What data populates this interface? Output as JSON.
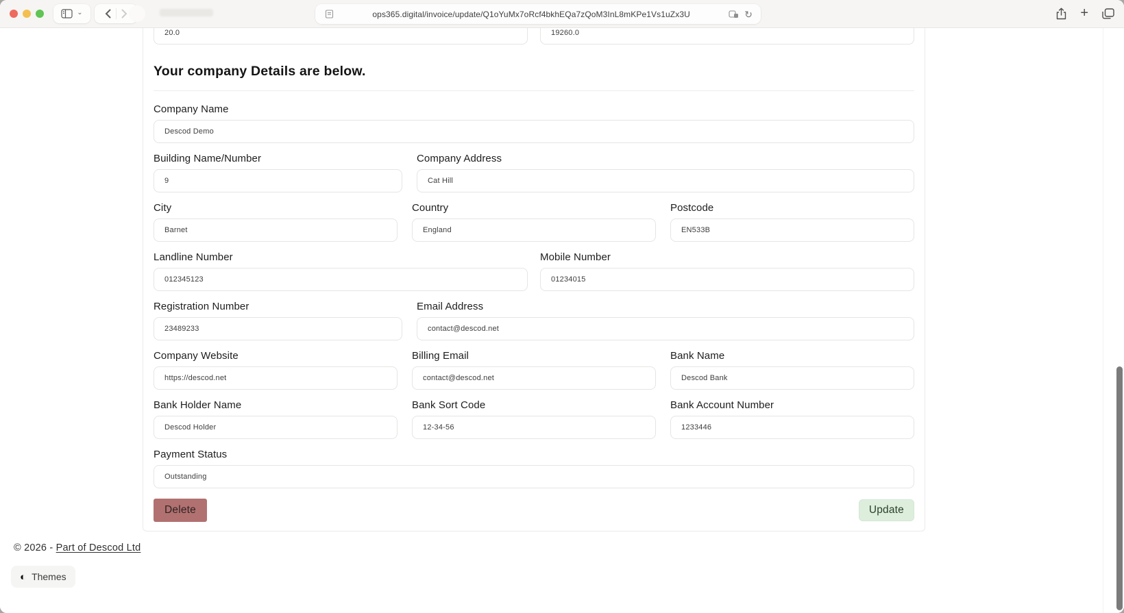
{
  "browser": {
    "url": "ops365.digital/invoice/update/Q1oYuMx7oRcf4bkhEQa7zQoM3InL8mKPe1Vs1uZx3U",
    "traffic_light_colors": {
      "close": "#ee6a5e",
      "minimize": "#f4bf4f",
      "zoom": "#61c454"
    },
    "icons": {
      "sidebar_toggle": "sidebar-panel",
      "chevron_down": "⌄",
      "back": "‹",
      "forward": "›",
      "reader": "page-lines",
      "privacy_badge": "badge",
      "refresh": "↻",
      "share": "square-arrow-up",
      "new_tab": "+",
      "tab_overview": "overlapping-squares"
    }
  },
  "page": {
    "partial_row": {
      "left_value": "20.0",
      "right_value": "19260.0"
    },
    "heading": "Your company Details are below.",
    "form": {
      "rows": [
        {
          "cols": [
            {
              "id": "company-name",
              "label": "Company Name",
              "value": "Descod Demo"
            }
          ]
        },
        {
          "cols": [
            {
              "id": "building-name-number",
              "label": "Building Name/Number",
              "value": "9"
            },
            {
              "id": "company-address",
              "label": "Company Address",
              "value": "Cat Hill"
            }
          ]
        },
        {
          "cols": [
            {
              "id": "city",
              "label": "City",
              "value": "Barnet"
            },
            {
              "id": "country",
              "label": "Country",
              "value": "England"
            },
            {
              "id": "postcode",
              "label": "Postcode",
              "value": "EN533B"
            }
          ]
        },
        {
          "cols": [
            {
              "id": "landline-number",
              "label": "Landline Number",
              "value": "012345123"
            },
            {
              "id": "mobile-number",
              "label": "Mobile Number",
              "value": "01234015"
            }
          ]
        },
        {
          "cols": [
            {
              "id": "registration-number",
              "label": "Registration Number",
              "value": "23489233"
            },
            {
              "id": "email-address",
              "label": "Email Address",
              "value": "contact@descod.net"
            }
          ]
        },
        {
          "cols": [
            {
              "id": "company-website",
              "label": "Company Website",
              "value": "https://descod.net"
            },
            {
              "id": "billing-email",
              "label": "Billing Email",
              "value": "contact@descod.net"
            },
            {
              "id": "bank-name",
              "label": "Bank Name",
              "value": "Descod Bank"
            }
          ]
        },
        {
          "cols": [
            {
              "id": "bank-holder-name",
              "label": "Bank Holder Name",
              "value": "Descod Holder"
            },
            {
              "id": "bank-sort-code",
              "label": "Bank Sort Code",
              "value": "12-34-56"
            },
            {
              "id": "bank-account-number",
              "label": "Bank Account Number",
              "value": "1233446"
            }
          ]
        },
        {
          "cols": [
            {
              "id": "payment-status",
              "label": "Payment Status",
              "value": "Outstanding"
            }
          ]
        }
      ]
    },
    "buttons": {
      "delete": "Delete",
      "update": "Update"
    },
    "button_colors": {
      "delete_bg": "#b17170",
      "update_bg": "#ddeedd"
    },
    "footer": {
      "copyright_prefix": "© 2026 - ",
      "link_text": "Part of Descod Ltd"
    },
    "themes": {
      "label": "Themes",
      "icon_glyph": "◐"
    }
  }
}
